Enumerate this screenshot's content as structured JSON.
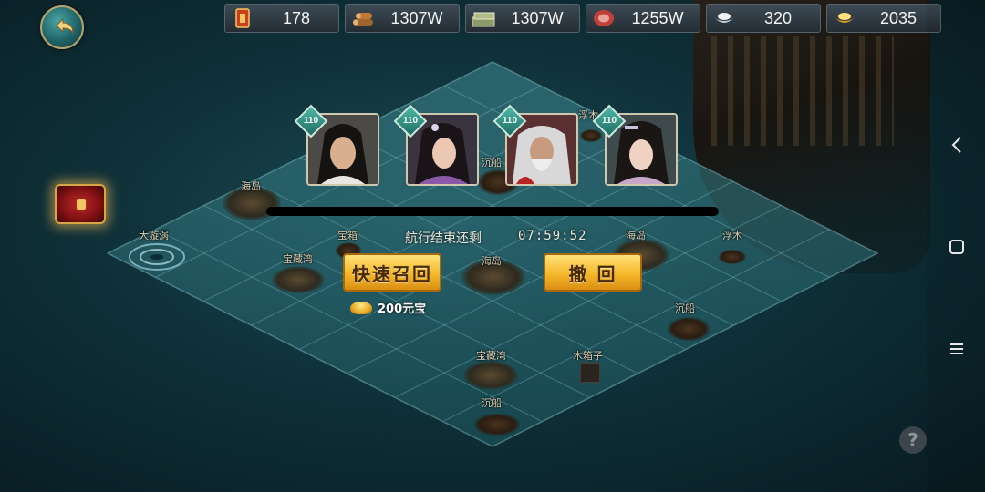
{
  "resources": [
    {
      "icon": "token-card-icon",
      "value": "178"
    },
    {
      "icon": "wood-logs-icon",
      "value": "1307W"
    },
    {
      "icon": "cash-stack-icon",
      "value": "1307W"
    },
    {
      "icon": "meat-icon",
      "value": "1255W"
    },
    {
      "icon": "silver-ingot-icon",
      "value": "320"
    },
    {
      "icon": "gold-ingot-icon",
      "value": "2035"
    }
  ],
  "heroes": [
    {
      "level": "110"
    },
    {
      "level": "110"
    },
    {
      "level": "110"
    },
    {
      "level": "110"
    }
  ],
  "map_labels": {
    "haidao_1": "海岛",
    "whirlpool": "大漩涡",
    "baoxiang_1": "宝箱",
    "baozangwan_1": "宝藏湾",
    "chenchuan_1": "沉船",
    "haidao_2": "海岛",
    "haidao_3": "海岛",
    "fumu": "浮木",
    "chenchuan_2": "沉船",
    "baozangwan_2": "宝藏湾",
    "muxiangzi": "木箱子",
    "chenchuan_3": "沉船",
    "fumu_2": "浮木"
  },
  "voyage": {
    "remaining_label": "航行结束还剩",
    "remaining_time": "07:59:52"
  },
  "actions": {
    "quick_recall_label": "快速召回",
    "withdraw_label": "撤 回",
    "quick_recall_cost": "200元宝"
  },
  "help_label": "?",
  "nav": {
    "back_icon": "chevron-left-icon",
    "home_icon": "square-icon",
    "menu_icon": "menu-icon"
  }
}
